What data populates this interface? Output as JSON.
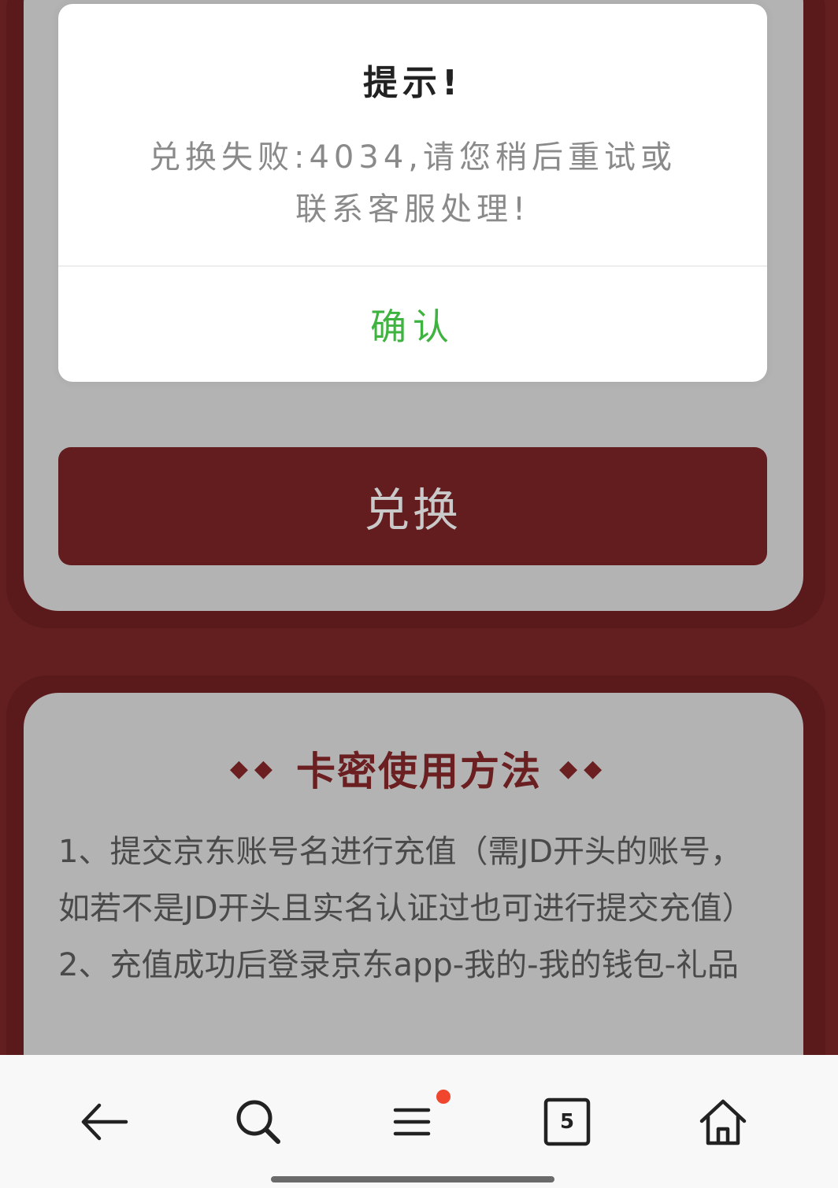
{
  "dialog": {
    "title": "提示!",
    "message_line1": "兑换失败:4034,请您稍后重试或",
    "message_line2": "联系客服处理!",
    "confirm_label": "确认"
  },
  "form": {
    "exchange_label": "兑换"
  },
  "help": {
    "title": "卡密使用方法",
    "decor_left": "◆◆",
    "decor_right": "◆◆",
    "step1": "1、提交京东账号名进行充值（需JD开头的账号，如若不是JD开头且实名认证过也可进行提交充值）",
    "step2": "2、充值成功后登录京东app-我的-我的钱包-礼品"
  },
  "browser_bar": {
    "tab_count": "5",
    "icons": [
      "back-arrow-icon",
      "search-icon",
      "menu-icon",
      "tabs-icon",
      "home-icon"
    ],
    "notification_color": "#f0462d"
  },
  "colors": {
    "brand_dark_red": "#641d1e",
    "confirm_green": "#3fb33f"
  }
}
